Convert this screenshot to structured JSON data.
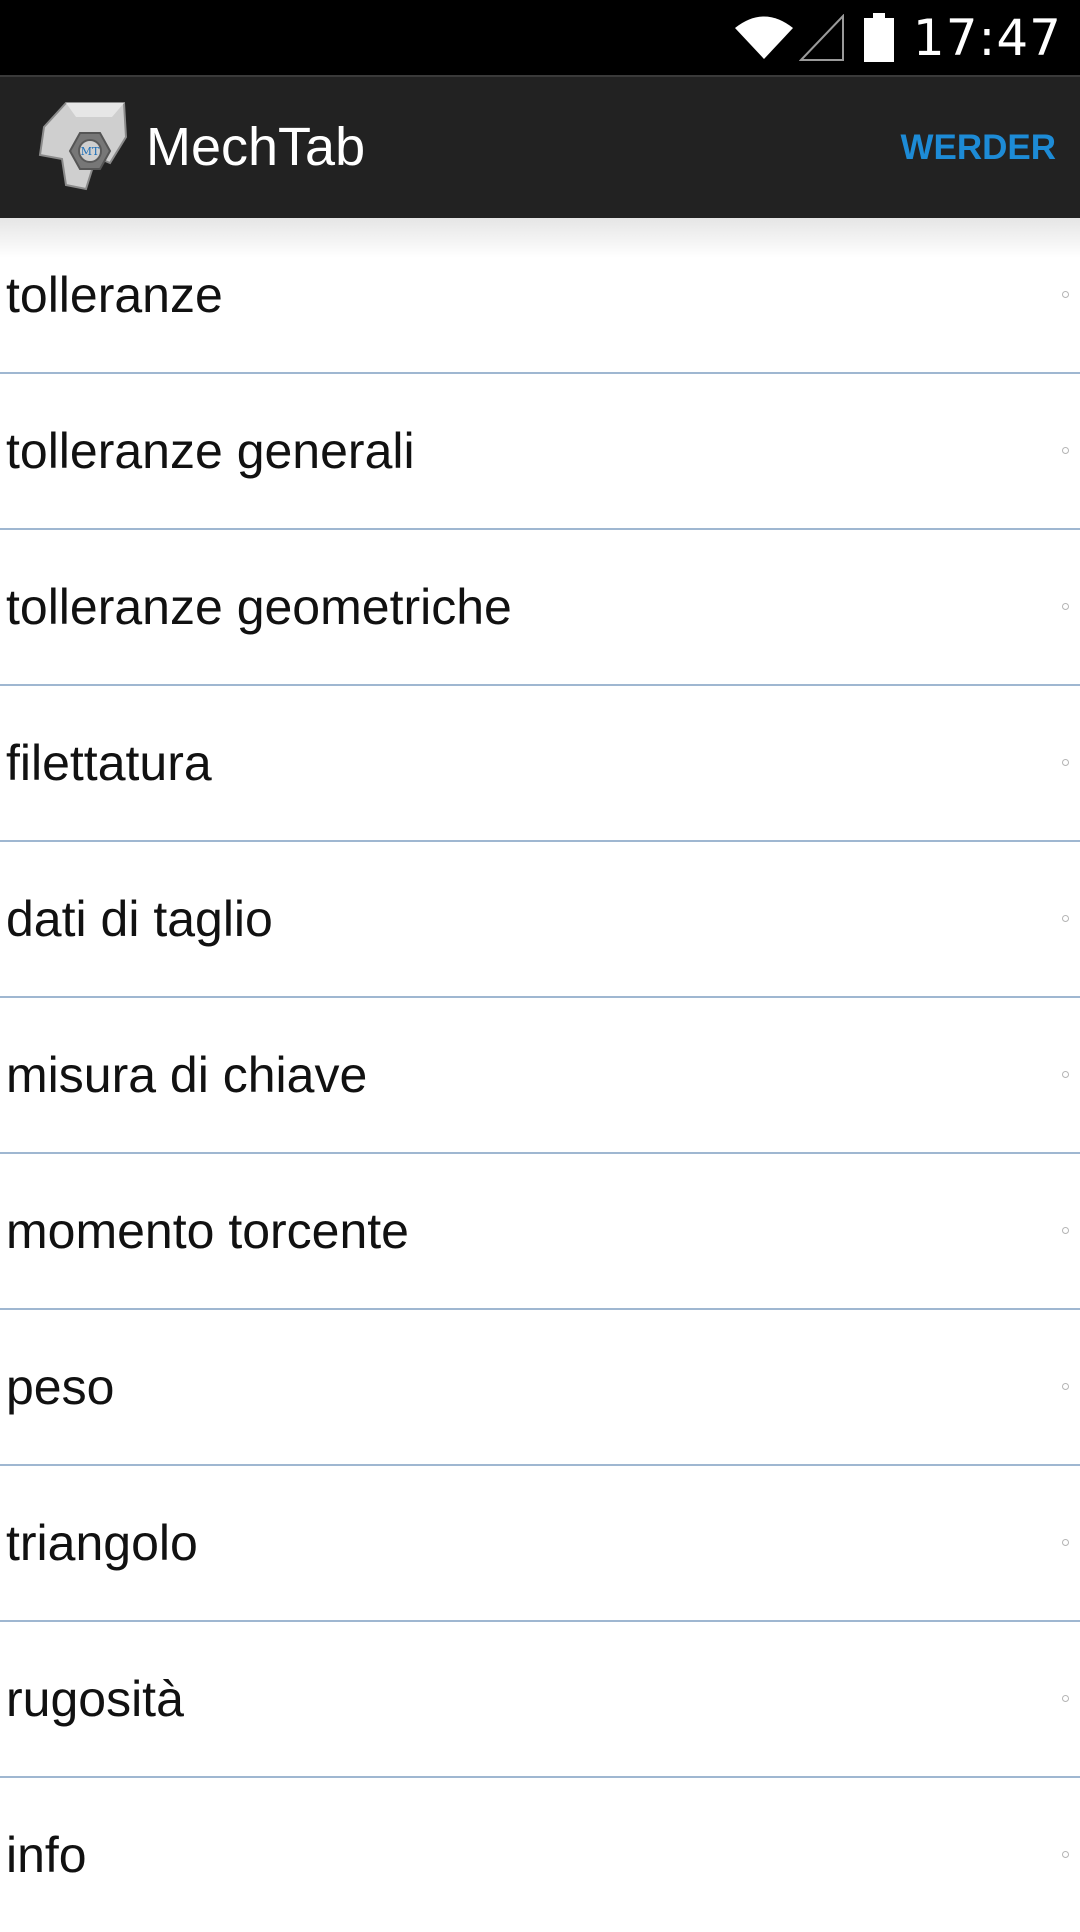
{
  "status_bar": {
    "time": "17:47",
    "icons": [
      "wifi-icon",
      "signal-icon",
      "battery-icon"
    ]
  },
  "action_bar": {
    "title": "MechTab",
    "logo_text": "MT",
    "action_label": "WERDER",
    "action_color": "#1d8bd6",
    "background": "#222222"
  },
  "menu": {
    "items": [
      {
        "label": "tolleranze"
      },
      {
        "label": "tolleranze generali"
      },
      {
        "label": "tolleranze geometriche"
      },
      {
        "label": "filettatura"
      },
      {
        "label": "dati di taglio"
      },
      {
        "label": "misura di chiave"
      },
      {
        "label": "momento torcente"
      },
      {
        "label": "peso"
      },
      {
        "label": "triangolo"
      },
      {
        "label": "rugosità"
      },
      {
        "label": "info"
      }
    ],
    "divider_color": "#9fb7d1"
  }
}
